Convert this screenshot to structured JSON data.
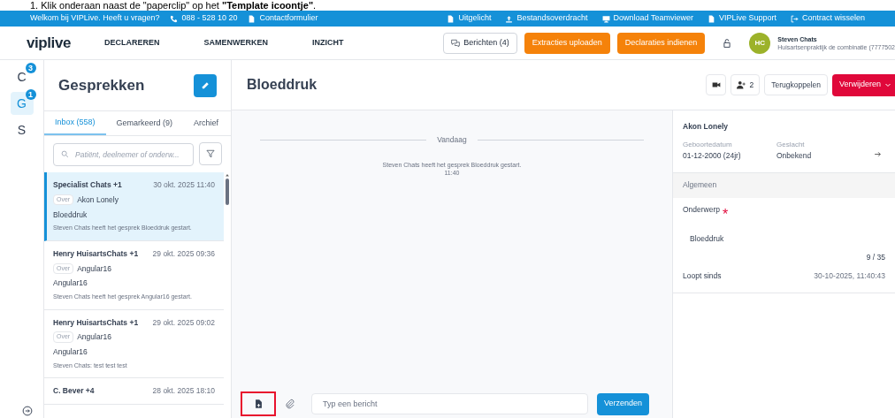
{
  "instruction": "1. Klik onderaan naast de \"paperclip\" op het **\"Template icoontje\"**.",
  "top_bar": {
    "left": [
      {
        "kind": "text",
        "label": "Welkom bij VIPLive. Heeft u vragen?"
      },
      {
        "kind": "phone",
        "label": "088 - 528 10 20"
      },
      {
        "kind": "file",
        "label": "Contactformulier"
      }
    ],
    "right": [
      {
        "kind": "file",
        "label": "Uitgelicht"
      },
      {
        "kind": "upload",
        "label": "Bestandsoverdracht"
      },
      {
        "kind": "monitor",
        "label": "Download Teamviewer"
      },
      {
        "kind": "file",
        "label": "VIPLive Support"
      },
      {
        "kind": "switch",
        "label": "Contract wisselen"
      }
    ]
  },
  "nav": {
    "logo": "viplive",
    "items": [
      "DECLAREREN",
      "SAMENWERKEN",
      "INZICHT"
    ],
    "messages_button": "Berichten (4)",
    "actions": [
      "Extracties uploaden",
      "Declaraties indienen"
    ],
    "user": {
      "initials": "HC",
      "name": "Steven Chats",
      "org": "Huisartsenpraktijk de combinatie (7777502"
    }
  },
  "rail": [
    {
      "label": "C",
      "badge": "3",
      "selected": false
    },
    {
      "label": "G",
      "badge": "1",
      "selected": true
    },
    {
      "label": "S",
      "selected": false
    }
  ],
  "conversations": {
    "title": "Gesprekken",
    "tabs": [
      {
        "label": "Inbox (558)",
        "selected": true
      },
      {
        "label": "Gemarkeerd (9)",
        "selected": false
      },
      {
        "label": "Archief",
        "selected": false
      }
    ],
    "search": {
      "placeholder": "Patiënt, deelnemer of onderw..."
    },
    "items": [
      {
        "participants": "Specialist Chats +1",
        "time": "30 okt. 2025 11:40",
        "over_label": "Over",
        "patient": "Akon Lonely",
        "subject": "Bloeddruk",
        "preview": "Steven Chats heeft het gesprek Bloeddruk gestart.",
        "selected": true
      },
      {
        "participants": "Henry HuisartsChats +1",
        "time": "29 okt. 2025 09:36",
        "over_label": "Over",
        "patient": "Angular16",
        "subject": "Angular16",
        "preview": "Steven Chats heeft het gesprek Angular16 gestart.",
        "selected": false
      },
      {
        "participants": "Henry HuisartsChats +1",
        "time": "29 okt. 2025 09:02",
        "over_label": "Over",
        "patient": "Angular16",
        "subject": "Angular16",
        "preview": "Steven Chats: test test test",
        "selected": false
      },
      {
        "participants": "C. Bever +4",
        "time": "28 okt. 2025 18:10",
        "selected": false
      }
    ]
  },
  "chat": {
    "title": "Bloeddruk",
    "participants_count": "2",
    "feedback_button": "Terugkoppelen",
    "delete_button": "Verwijderen",
    "day_separator": "Vandaag",
    "events": [
      {
        "text": "Steven Chats heeft het gesprek Bloeddruk gestart.",
        "time": "11:40"
      }
    ],
    "input": {
      "placeholder": "Typ een bericht"
    },
    "send_button": "Verzenden"
  },
  "details": {
    "patient": "Akon Lonely",
    "fields": [
      {
        "label": "Geboortedatum",
        "value": "01-12-2000 (24jr)"
      },
      {
        "label": "Geslacht",
        "value": "Onbekend"
      }
    ],
    "section": "Algemeen",
    "subject_label": "Onderwerp",
    "required_mark": "*",
    "subject_value": "Bloeddruk",
    "counter": "9 / 35",
    "since_label": "Loopt sinds",
    "since_value": "30-10-2025, 11:40:43"
  }
}
